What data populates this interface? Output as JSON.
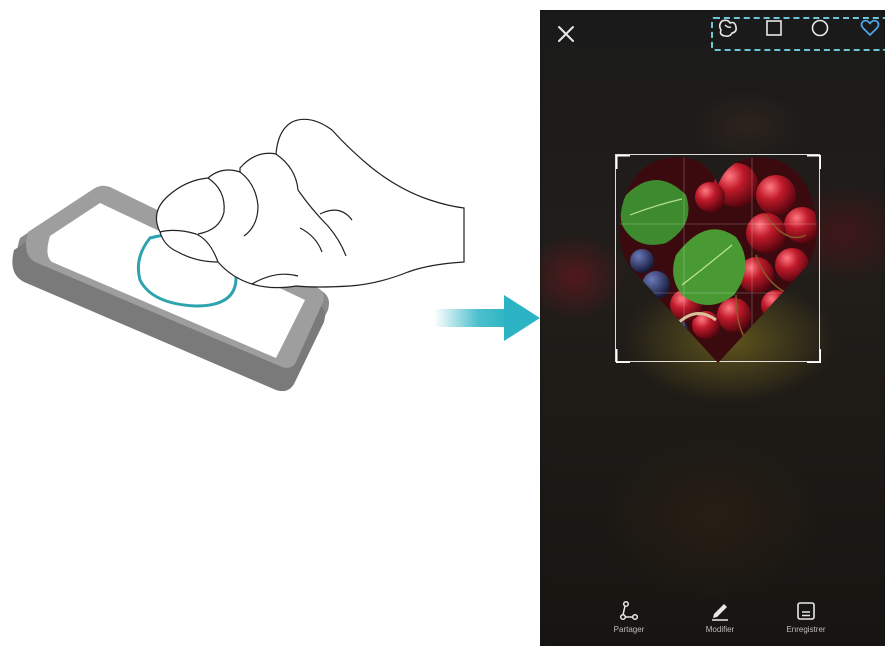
{
  "illustration": {
    "gesture": "knuckle-draw-circle",
    "accent_color": "#2ea3b0"
  },
  "arrow": {
    "color": "#2db4c4"
  },
  "screenshot_editor": {
    "close_icon": "close-icon",
    "shape_options": [
      {
        "name": "freeform",
        "icon": "freeform-shape-icon",
        "selected": false
      },
      {
        "name": "rectangle",
        "icon": "rectangle-shape-icon",
        "selected": false
      },
      {
        "name": "circle",
        "icon": "circle-shape-icon",
        "selected": false
      },
      {
        "name": "heart",
        "icon": "heart-shape-icon",
        "selected": true
      }
    ],
    "selected_color": "#4aa8e8",
    "actions": [
      {
        "label": "Partager",
        "icon": "share-icon"
      },
      {
        "label": "Modifier",
        "icon": "pen-icon"
      },
      {
        "label": "Enregistrer",
        "icon": "save-icon"
      }
    ]
  }
}
